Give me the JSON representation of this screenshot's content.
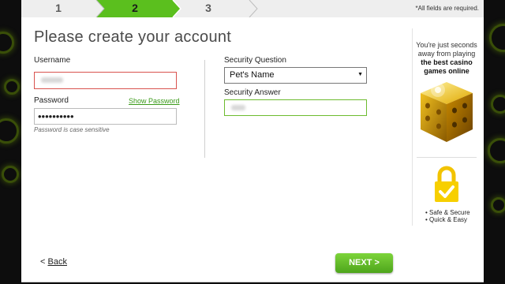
{
  "steps": [
    {
      "number": "1",
      "active": false
    },
    {
      "number": "2",
      "active": true
    },
    {
      "number": "3",
      "active": false
    }
  ],
  "required_note": "*All fields are required.",
  "form": {
    "title": "Please create your account",
    "username_label": "Username",
    "password_label": "Password",
    "show_password": "Show Password",
    "password_value": "••••••••••",
    "password_hint": "Password is case sensitive",
    "security_question_label": "Security Question",
    "security_question_value": "Pet's Name",
    "security_answer_label": "Security Answer"
  },
  "sidebar": {
    "tagline": "You're just seconds away from playing",
    "highlight": "the best casino games online",
    "bullets": [
      "• Safe & Secure",
      "• Quick & Easy"
    ]
  },
  "nav": {
    "back_arrow": "<",
    "back_label": "Back",
    "next_label": "NEXT >"
  },
  "colors": {
    "accent_green": "#5bbf1e",
    "error_red": "#d9534f",
    "valid_green": "#6dbb2f"
  }
}
